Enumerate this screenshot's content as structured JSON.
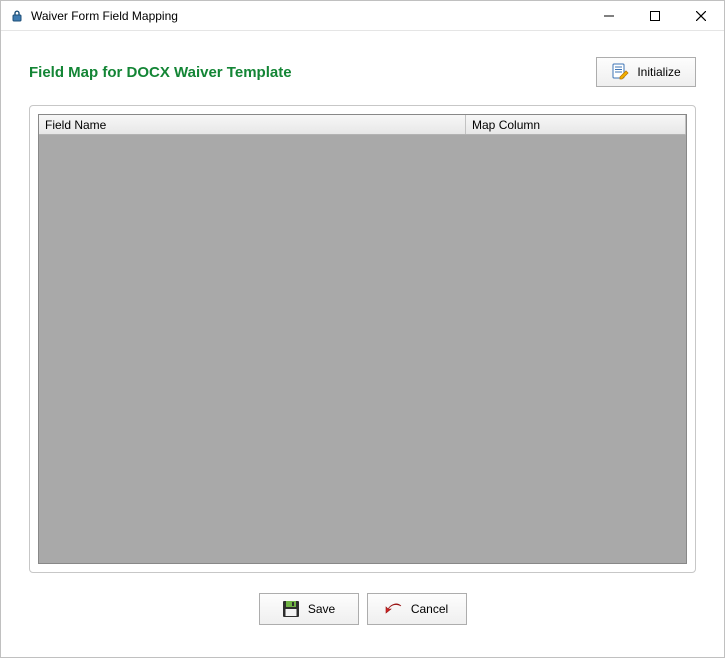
{
  "window": {
    "title": "Waiver Form Field Mapping"
  },
  "header": {
    "title": "Field Map for DOCX Waiver Template"
  },
  "buttons": {
    "initialize": "Initialize",
    "save": "Save",
    "cancel": "Cancel"
  },
  "grid": {
    "columns": {
      "field_name": "Field Name",
      "map_column": "Map Column"
    },
    "rows": []
  }
}
